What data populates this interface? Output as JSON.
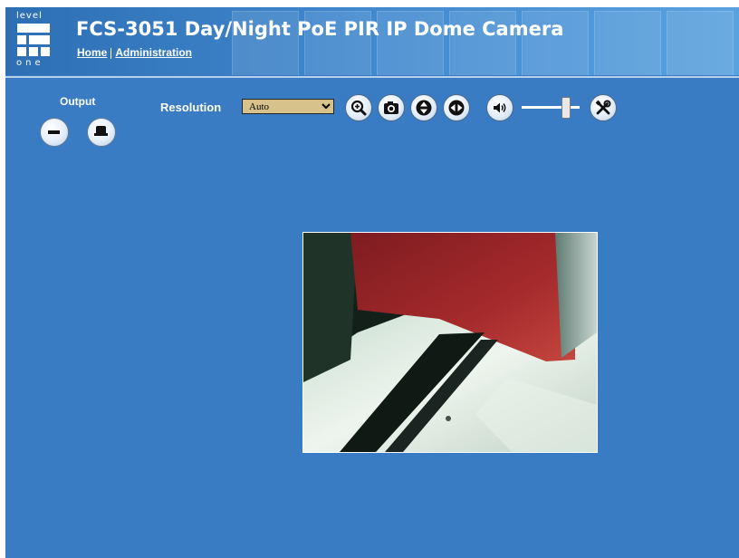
{
  "header": {
    "logo_top": "level",
    "logo_bottom": "one",
    "title": "FCS-3051 Day/Night PoE PIR IP Dome Camera",
    "nav": {
      "home": "Home",
      "administration": "Administration"
    }
  },
  "output": {
    "label": "Output"
  },
  "resolution": {
    "label": "Resolution",
    "selected": "Auto"
  },
  "volume": {
    "level_fraction": 0.75
  },
  "icons": {
    "zoom": "zoom-in-icon",
    "snapshot": "camera-icon",
    "tilt": "up-down-arrows-icon",
    "pan": "left-right-arrows-icon",
    "audio": "speaker-icon",
    "settings": "tools-icon"
  },
  "colors": {
    "background": "#3a7cc4",
    "header": "#3f86cc",
    "select_bg": "#d6c28a"
  }
}
